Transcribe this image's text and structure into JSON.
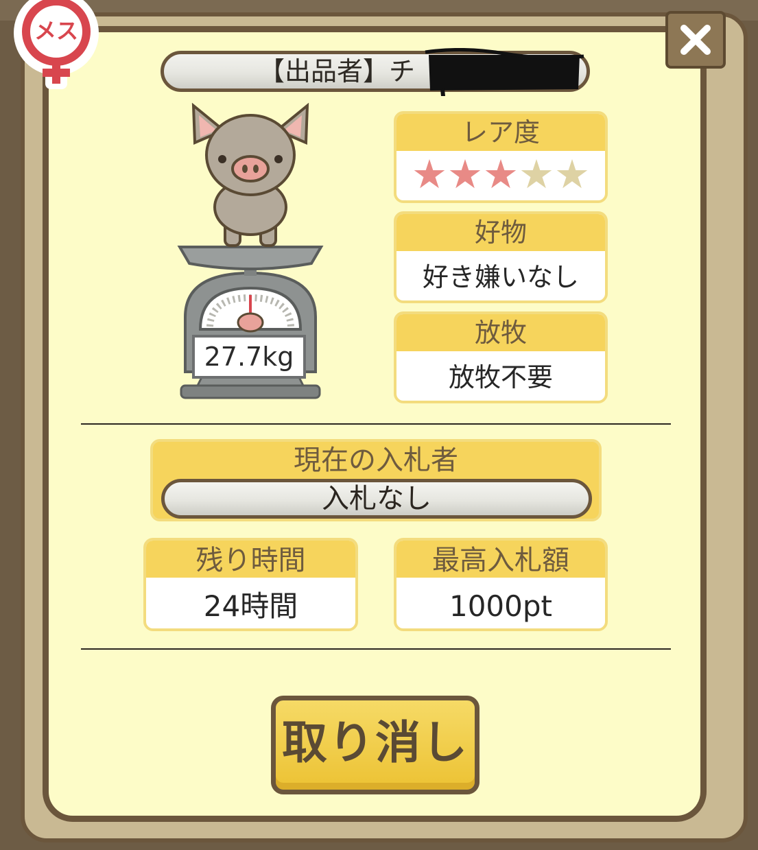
{
  "gender_badge": "メス",
  "seller": {
    "label": "【出品者】チ"
  },
  "weight": "27.7kg",
  "rarity": {
    "title": "レア度",
    "stars_filled": 3,
    "stars_total": 5
  },
  "favorite": {
    "title": "好物",
    "value": "好き嫌いなし"
  },
  "grazing": {
    "title": "放牧",
    "value": "放牧不要"
  },
  "bidder": {
    "title": "現在の入札者",
    "value": "入札なし"
  },
  "remaining": {
    "title": "残り時間",
    "value": "24時間"
  },
  "highest_bid": {
    "title": "最高入札額",
    "value": "1000pt"
  },
  "cancel_label": "取り消し",
  "close_icon": "close-icon",
  "colors": {
    "accent": "#f6d45c",
    "panel": "#fdfcc8",
    "border": "#6b563c",
    "star_on": "#e88a86",
    "star_off": "#ded2a4"
  }
}
